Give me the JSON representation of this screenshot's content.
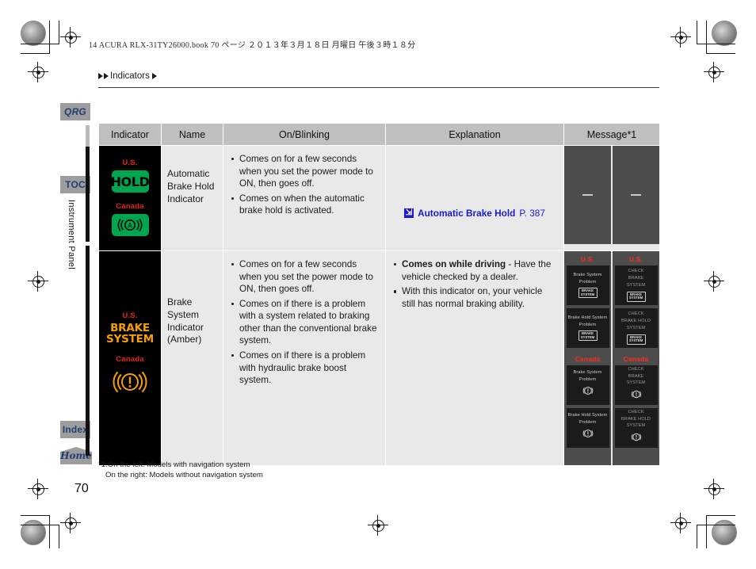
{
  "book_header": "14 ACURA RLX-31TY26000.book   70 ページ   ２０１３年３月１８日   月曜日   午後３時１８分",
  "breadcrumb": {
    "label": "Indicators"
  },
  "side_tabs": {
    "qrg": "QRG",
    "toc": "TOC",
    "index": "Index",
    "home": "Home",
    "vertical_label": "Instrument Panel"
  },
  "table": {
    "headers": [
      "Indicator",
      "Name",
      "On/Blinking",
      "Explanation",
      "Message*1"
    ],
    "rows": [
      {
        "indicator": {
          "us_label": "U.S.",
          "us_badge_text": "HOLD",
          "canada_label": "Canada",
          "canada_badge_icon": "auto-brake-hold-icon"
        },
        "name": "Automatic\nBrake Hold\nIndicator",
        "on_blinking": [
          "Comes on for a few seconds when you set the power mode to ON, then goes off.",
          "Comes on when the automatic brake hold is activated."
        ],
        "explanation_link": {
          "icon": "jump-link-icon",
          "text": "Automatic Brake Hold",
          "page_ref": "P. 387"
        },
        "message_left": "—",
        "message_right": "—"
      },
      {
        "indicator": {
          "us_label": "U.S.",
          "us_text_line1": "BRAKE",
          "us_text_line2": "SYSTEM",
          "canada_label": "Canada",
          "canada_badge_icon": "brake-system-warning-icon"
        },
        "name": "Brake System\nIndicator\n(Amber)",
        "on_blinking": [
          "Comes on for a few seconds when you set the power mode to ON, then goes off.",
          "Comes on if there is a problem with a system related to braking other than the conventional brake system.",
          "Comes on if there is a problem with hydraulic brake boost system."
        ],
        "explanation_bullets": [
          {
            "bold": "Comes on while driving",
            "rest": " - Have the vehicle checked by a dealer."
          },
          {
            "bold": "",
            "rest": "With this indicator on, your vehicle still has normal braking ability."
          }
        ],
        "message_left": {
          "us_label": "U.S.",
          "canada_label": "Canada",
          "screens": [
            {
              "region": "us",
              "lines": [
                "Brake System",
                "Problem"
              ],
              "badge": [
                "BRAKE",
                "SYSTEM"
              ]
            },
            {
              "region": "us",
              "lines": [
                "Brake Hold System",
                "Problem"
              ],
              "badge": [
                "BRAKE",
                "SYSTEM"
              ]
            },
            {
              "region": "canada",
              "lines": [
                "Brake System",
                "Problem"
              ],
              "icon": "brake-warning-circle-icon"
            },
            {
              "region": "canada",
              "lines": [
                "Brake Hold System",
                "Problem"
              ],
              "icon": "brake-warning-circle-icon"
            }
          ]
        },
        "message_right": {
          "us_label": "U.S.",
          "canada_label": "Canada",
          "screens": [
            {
              "region": "us",
              "lines": [
                "CHECK",
                "BRAKE",
                "SYSTEM"
              ],
              "badge": [
                "BRAKE",
                "SYSTEM"
              ]
            },
            {
              "region": "us",
              "lines": [
                "CHECK",
                "BRAKE HOLD",
                "SYSTEM"
              ],
              "badge": [
                "BRAKE",
                "SYSTEM"
              ]
            },
            {
              "region": "canada",
              "lines": [
                "CHECK",
                "BRAKE",
                "SYSTEM"
              ],
              "icon": "brake-warning-circle-icon"
            },
            {
              "region": "canada",
              "lines": [
                "CHECK",
                "BRAKE HOLD",
                "SYSTEM"
              ],
              "icon": "brake-warning-circle-icon"
            }
          ]
        }
      }
    ]
  },
  "footnote": {
    "line1": "*1:On the left: Models with navigation system",
    "line2": "On the right: Models without navigation system"
  },
  "page_number": "70",
  "colors": {
    "header_bg": "#bfbfbf",
    "cell_bg": "#e9e9e9",
    "indicator_bg": "#000000",
    "green_badge": "#00a550",
    "amber": "#f5a000",
    "red_label": "#e8231f",
    "link_blue": "#1a1acc",
    "tab_bg": "#9d9d9d",
    "tab_text": "#1f3f73",
    "msg_panel": "#4c4c4c",
    "msg_screen": "#1b1b1b"
  }
}
